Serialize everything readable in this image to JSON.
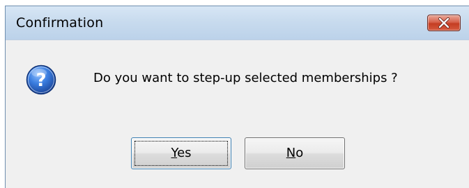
{
  "window": {
    "title": "Confirmation"
  },
  "dialog": {
    "message": "Do you want to step-up selected memberships ?",
    "icon": "question-icon"
  },
  "buttons": {
    "yes": {
      "mnemonic": "Y",
      "rest": "es"
    },
    "no": {
      "mnemonic": "N",
      "rest": "o"
    }
  },
  "colors": {
    "close_button": "#c43d22",
    "title_bar": "#c8dbee",
    "icon_blue": "#2a66c4"
  }
}
